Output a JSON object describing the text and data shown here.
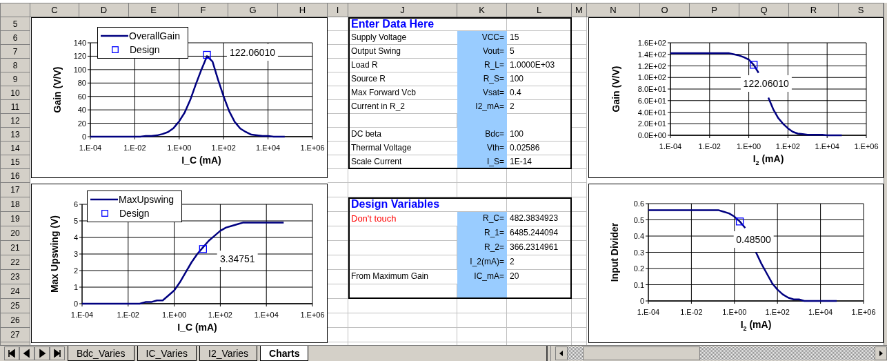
{
  "column_headers": [
    "C",
    "D",
    "E",
    "F",
    "G",
    "H",
    "I",
    "J",
    "K",
    "L",
    "M",
    "N",
    "O",
    "P",
    "Q",
    "R",
    "S"
  ],
  "row_headers": [
    "5",
    "6",
    "7",
    "8",
    "9",
    "10",
    "11",
    "12",
    "13",
    "14",
    "15",
    "16",
    "17",
    "18",
    "19",
    "20",
    "21",
    "22",
    "23",
    "24",
    "25",
    "26",
    "27"
  ],
  "input_table": {
    "title": "Enter Data Here",
    "rows": [
      {
        "kind": "data",
        "label": "Supply Voltage",
        "name": "VCC=",
        "value": "15"
      },
      {
        "kind": "data",
        "label": "Output Swing",
        "name": "Vout=",
        "value": "5"
      },
      {
        "kind": "data",
        "label": "Load R",
        "name": "R_L=",
        "value": "1.0000E+03"
      },
      {
        "kind": "data",
        "label": "Source R",
        "name": "R_S=",
        "value": "100"
      },
      {
        "kind": "data",
        "label": "Max Forward Vcb",
        "name": "Vsat=",
        "value": "0.4"
      },
      {
        "kind": "data",
        "label": "Current in R_2",
        "name": "I2_mA=",
        "value": "2"
      },
      {
        "kind": "blank"
      },
      {
        "kind": "data",
        "label": "DC beta",
        "name": "Bdc=",
        "value": "100"
      },
      {
        "kind": "data",
        "label": "Thermal Voltage",
        "name": "Vth=",
        "value": "0.02586"
      },
      {
        "kind": "data",
        "label": "Scale Current",
        "name": "I_S=",
        "value": "1E-14"
      }
    ]
  },
  "design_table": {
    "title": "Design Variables",
    "rows": [
      {
        "kind": "warning",
        "label": "Don't touch",
        "name": "R_C=",
        "value": "482.3834923"
      },
      {
        "kind": "data",
        "name": "R_1=",
        "value": "6485.244094"
      },
      {
        "kind": "data",
        "name": "R_2=",
        "value": "366.2314961"
      },
      {
        "kind": "data",
        "name": "I_2(mA)=",
        "value": "2"
      },
      {
        "kind": "data",
        "label": "From Maximum Gain",
        "name": "IC_mA=",
        "value": "20"
      },
      {
        "kind": "blank"
      }
    ]
  },
  "charts": [
    {
      "chart_data": {
        "type": "line",
        "xlabel": "I_C (mA)",
        "ylabel": "Gain (V/V)",
        "grid": true,
        "legend": "upper left",
        "categories": [
          "1.E-04",
          null,
          null,
          null,
          null,
          null,
          null,
          null,
          "1.E-02",
          null,
          null,
          null,
          null,
          null,
          null,
          null,
          "1.E+00",
          null,
          null,
          null,
          null,
          null,
          null,
          null,
          "1.E+02",
          null,
          null,
          null,
          null,
          null,
          null,
          null,
          "1.E+04",
          null,
          null,
          null,
          null,
          null,
          null,
          null,
          "1.E+06"
        ],
        "series": [
          {
            "name": "OverallGain",
            "color": "#000080",
            "values": [
              0,
              0,
              0,
              0,
              0,
              0,
              0,
              0,
              0,
              0,
              1,
              1,
              2,
              4,
              7,
              13,
              23,
              36,
              55,
              78,
              100,
              120,
              112,
              85,
              60,
              38,
              22,
              12,
              7,
              3,
              2,
              1,
              1,
              0,
              0,
              0,
              null,
              null,
              null,
              null,
              null
            ]
          },
          {
            "name": "Design",
            "color": "#0000ff",
            "marker": "square",
            "values": [
              null,
              null,
              null,
              null,
              null,
              null,
              null,
              null,
              null,
              null,
              null,
              null,
              null,
              null,
              null,
              null,
              null,
              null,
              null,
              null,
              null,
              122,
              null,
              null,
              null,
              null,
              null,
              null,
              null,
              null,
              null,
              null,
              null,
              null,
              null,
              null,
              null,
              null,
              null,
              null,
              null
            ]
          }
        ],
        "ylim": [
          0,
          140
        ],
        "yticks": [
          0,
          20,
          40,
          60,
          80,
          100,
          120,
          140
        ],
        "annotations": [
          "122.06010"
        ]
      }
    },
    {
      "chart_data": {
        "type": "line",
        "xlabel": "I_C (mA)",
        "ylabel": "Max Upswing (V)",
        "grid": true,
        "legend": "upper left",
        "categories": [
          "1.E-04",
          null,
          null,
          null,
          null,
          null,
          null,
          null,
          "1.E-02",
          null,
          null,
          null,
          null,
          null,
          null,
          null,
          "1.E+00",
          null,
          null,
          null,
          null,
          null,
          null,
          null,
          "1.E+02",
          null,
          null,
          null,
          null,
          null,
          null,
          null,
          "1.E+04",
          null,
          null,
          null,
          null,
          null,
          null,
          null,
          "1.E+06"
        ],
        "series": [
          {
            "name": "MaxUpswing",
            "color": "#000080",
            "values": [
              0,
              0,
              0,
              0,
              0,
              0,
              0,
              0,
              0,
              0,
              0,
              0.1,
              0.1,
              0.2,
              0.2,
              0.5,
              0.8,
              1.3,
              1.9,
              2.5,
              3,
              3.4,
              3.8,
              4.1,
              4.4,
              4.6,
              4.7,
              4.8,
              4.9,
              4.9,
              4.9,
              4.9,
              4.9,
              4.9,
              4.9,
              4.9,
              null,
              null,
              null,
              null,
              null
            ]
          },
          {
            "name": "Design",
            "color": "#0000ff",
            "marker": "square",
            "values": [
              null,
              null,
              null,
              null,
              null,
              null,
              null,
              null,
              null,
              null,
              null,
              null,
              null,
              null,
              null,
              null,
              null,
              null,
              null,
              null,
              null,
              3.3,
              null,
              null,
              null,
              null,
              null,
              null,
              null,
              null,
              null,
              null,
              null,
              null,
              null,
              null,
              null,
              null,
              null,
              null,
              null
            ]
          }
        ],
        "ylim": [
          0,
          6
        ],
        "yticks": [
          0,
          1,
          2,
          3,
          4,
          5,
          6
        ],
        "annotations": [
          "3.34751"
        ]
      }
    },
    {
      "chart_data": {
        "type": "line",
        "xlabel": "I$_{2}$ (mA)",
        "ylabel": "Gain (V/V)",
        "grid": true,
        "categories": [
          "1.E-04",
          null,
          null,
          null,
          null,
          null,
          null,
          null,
          "1.E-02",
          null,
          null,
          null,
          null,
          null,
          null,
          null,
          "1.E+00",
          null,
          null,
          null,
          null,
          null,
          null,
          null,
          "1.E+02",
          null,
          null,
          null,
          null,
          null,
          null,
          null,
          "1.E+04",
          null,
          null,
          null,
          null,
          null,
          null,
          null,
          "1.E+06"
        ],
        "series": [
          {
            "color": "#000080",
            "values": [
              142,
              142,
              142,
              142,
              142,
              142,
              142,
              142,
              142,
              142,
              142,
              142,
              142,
              140,
              138,
              135,
              131,
              122,
              108,
              null,
              65,
              45,
              30,
              20,
              12,
              6,
              3,
              2,
              1,
              1,
              1,
              1,
              0,
              0,
              0,
              0,
              null,
              null,
              null,
              null,
              null
            ]
          },
          {
            "color": "#0000ff",
            "marker": "square",
            "values": [
              null,
              null,
              null,
              null,
              null,
              null,
              null,
              null,
              null,
              null,
              null,
              null,
              null,
              null,
              null,
              null,
              null,
              122,
              null,
              null,
              null,
              null,
              null,
              null,
              null,
              null,
              null,
              null,
              null,
              null,
              null,
              null,
              null,
              null,
              null,
              null,
              null,
              null,
              null,
              null,
              null
            ]
          }
        ],
        "ylim": [
          0,
          160
        ],
        "yticks": [
          {
            "value": 0,
            "label": "0.0E+00"
          },
          {
            "value": 20,
            "label": "2.0E+01"
          },
          {
            "value": 40,
            "label": "4.0E+01"
          },
          {
            "value": 60,
            "label": "6.0E+01"
          },
          {
            "value": 80,
            "label": "8.0E+01"
          },
          {
            "value": 100,
            "label": "1.0E+02"
          },
          {
            "value": 120,
            "label": "1.2E+02"
          },
          {
            "value": 140,
            "label": "1.4E+02"
          },
          {
            "value": 160,
            "label": "1.6E+02"
          }
        ],
        "annotations": [
          "122.06010"
        ]
      }
    },
    {
      "chart_data": {
        "type": "line",
        "xlabel": "I$_{2}$ (mA)",
        "ylabel": "Input Divider",
        "grid": true,
        "categories": [
          "1.E-04",
          null,
          null,
          null,
          null,
          null,
          null,
          null,
          "1.E-02",
          null,
          null,
          null,
          null,
          null,
          null,
          null,
          "1.E+00",
          null,
          null,
          null,
          null,
          null,
          null,
          null,
          "1.E+02",
          null,
          null,
          null,
          null,
          null,
          null,
          null,
          "1.E+04",
          null,
          null,
          null,
          null,
          null,
          null,
          null,
          "1.E+06"
        ],
        "series": [
          {
            "color": "#000080",
            "values": [
              0.56,
              0.56,
              0.56,
              0.56,
              0.56,
              0.56,
              0.56,
              0.56,
              0.56,
              0.56,
              0.56,
              0.56,
              0.56,
              0.56,
              0.55,
              0.54,
              0.52,
              0.49,
              0.45,
              null,
              0.3,
              0.23,
              0.17,
              0.11,
              0.07,
              0.04,
              0.02,
              0.01,
              0.01,
              0,
              0,
              0,
              0,
              0,
              0,
              0,
              null,
              null,
              null,
              null,
              null
            ]
          },
          {
            "color": "#0000ff",
            "marker": "square",
            "values": [
              null,
              null,
              null,
              null,
              null,
              null,
              null,
              null,
              null,
              null,
              null,
              null,
              null,
              null,
              null,
              null,
              null,
              0.49,
              null,
              null,
              null,
              null,
              null,
              null,
              null,
              null,
              null,
              null,
              null,
              null,
              null,
              null,
              null,
              null,
              null,
              null,
              null,
              null,
              null,
              null,
              null
            ]
          }
        ],
        "ylim": [
          0,
          0.6
        ],
        "yticks": [
          0,
          0.1,
          0.2,
          0.3,
          0.4,
          0.5,
          0.6
        ],
        "annotations": [
          "0.48500"
        ]
      }
    }
  ],
  "sheet_tabs": [
    {
      "label": "Bdc_Varies",
      "selected": false
    },
    {
      "label": "IC_Varies",
      "selected": false
    },
    {
      "label": "I2_Varies",
      "selected": false
    },
    {
      "label": "Charts",
      "selected": true
    }
  ]
}
